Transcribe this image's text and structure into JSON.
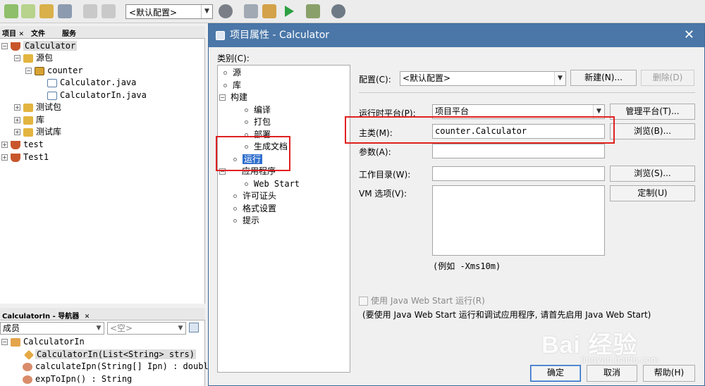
{
  "toolbar": {
    "config_value": "<默认配置>",
    "colors": {
      "run": "#2ea043",
      "new": "#6aa84f"
    }
  },
  "projects_panel": {
    "tabs": [
      "项目",
      "文件",
      "服务"
    ],
    "tab_close": "✕",
    "tree": [
      {
        "label": "Calculator",
        "icon": "project-cup-icon",
        "expanded": true,
        "selected": true
      },
      {
        "label": "源包",
        "icon": "folder-icon",
        "expanded": true
      },
      {
        "label": "counter",
        "icon": "package-icon",
        "expanded": true
      },
      {
        "label": "Calculator.java",
        "icon": "java-file-icon"
      },
      {
        "label": "CalculatorIn.java",
        "icon": "java-file-icon"
      },
      {
        "label": "测试包",
        "icon": "folder-icon",
        "expanded": false
      },
      {
        "label": "库",
        "icon": "folder-icon",
        "expanded": false
      },
      {
        "label": "测试库",
        "icon": "folder-icon",
        "expanded": false
      },
      {
        "label": "test",
        "icon": "project-cup-icon",
        "expanded": false
      },
      {
        "label": "Test1",
        "icon": "project-cup-icon",
        "expanded": false
      }
    ]
  },
  "navigator": {
    "title": "CalculatorIn - 导航器",
    "close": "✕",
    "members_label": "成员",
    "filter_value": "<空>",
    "items": [
      {
        "label": "CalculatorIn",
        "icon": "class-icon"
      },
      {
        "label": "CalculatorIn(List<String> strs)",
        "icon": "constructor-icon"
      },
      {
        "label": "calculateIpn(String[] Ipn) : doubl",
        "icon": "method-icon"
      },
      {
        "label": "expToIpn() : String",
        "icon": "method-icon"
      }
    ]
  },
  "dialog": {
    "title": "项目属性 - Calculator",
    "close": "✕",
    "category_label": "类别(C):",
    "categories": [
      {
        "label": "源",
        "level": 0
      },
      {
        "label": "库",
        "level": 0
      },
      {
        "label": "构建",
        "level": 0,
        "expanded": true
      },
      {
        "label": "编译",
        "level": 1
      },
      {
        "label": "打包",
        "level": 1
      },
      {
        "label": "部署",
        "level": 1
      },
      {
        "label": "生成文档",
        "level": 1
      },
      {
        "label": "运行",
        "level": 0,
        "selected": true
      },
      {
        "label": "应用程序",
        "level": 0,
        "expanded": true
      },
      {
        "label": "Web Start",
        "level": 1
      },
      {
        "label": "许可证头",
        "level": 0
      },
      {
        "label": "格式设置",
        "level": 0
      },
      {
        "label": "提示",
        "level": 0
      }
    ],
    "config_label": "配置(C):",
    "config_value": "<默认配置>",
    "new_button": "新建(N)...",
    "delete_button": "删除(D)",
    "runtime_label": "运行时平台(P):",
    "runtime_value": "项目平台",
    "manage_platform_button": "管理平台(T)...",
    "main_class_label": "主类(M):",
    "main_class_value": "counter.Calculator",
    "browse_b_button": "浏览(B)...",
    "args_label": "参数(A):",
    "args_value": "",
    "workdir_label": "工作目录(W):",
    "workdir_value": "",
    "browse_s_button": "浏览(S)...",
    "vm_label": "VM 选项(V):",
    "vm_value": "",
    "customize_button": "定制(U)",
    "vm_hint": "(例如 -Xms10m)",
    "webstart_checkbox": "使用 Java Web Start 运行(R)",
    "webstart_note": "(要使用 Java Web Start 运行和调试应用程序, 请首先启用 Java Web Start)",
    "ok_button": "确定",
    "cancel_button": "取消",
    "help_button": "帮助(H)"
  },
  "watermark": {
    "brand": "Bai 经验",
    "url": "jingyan.baidu.com"
  },
  "highlight_color": "#e02020"
}
